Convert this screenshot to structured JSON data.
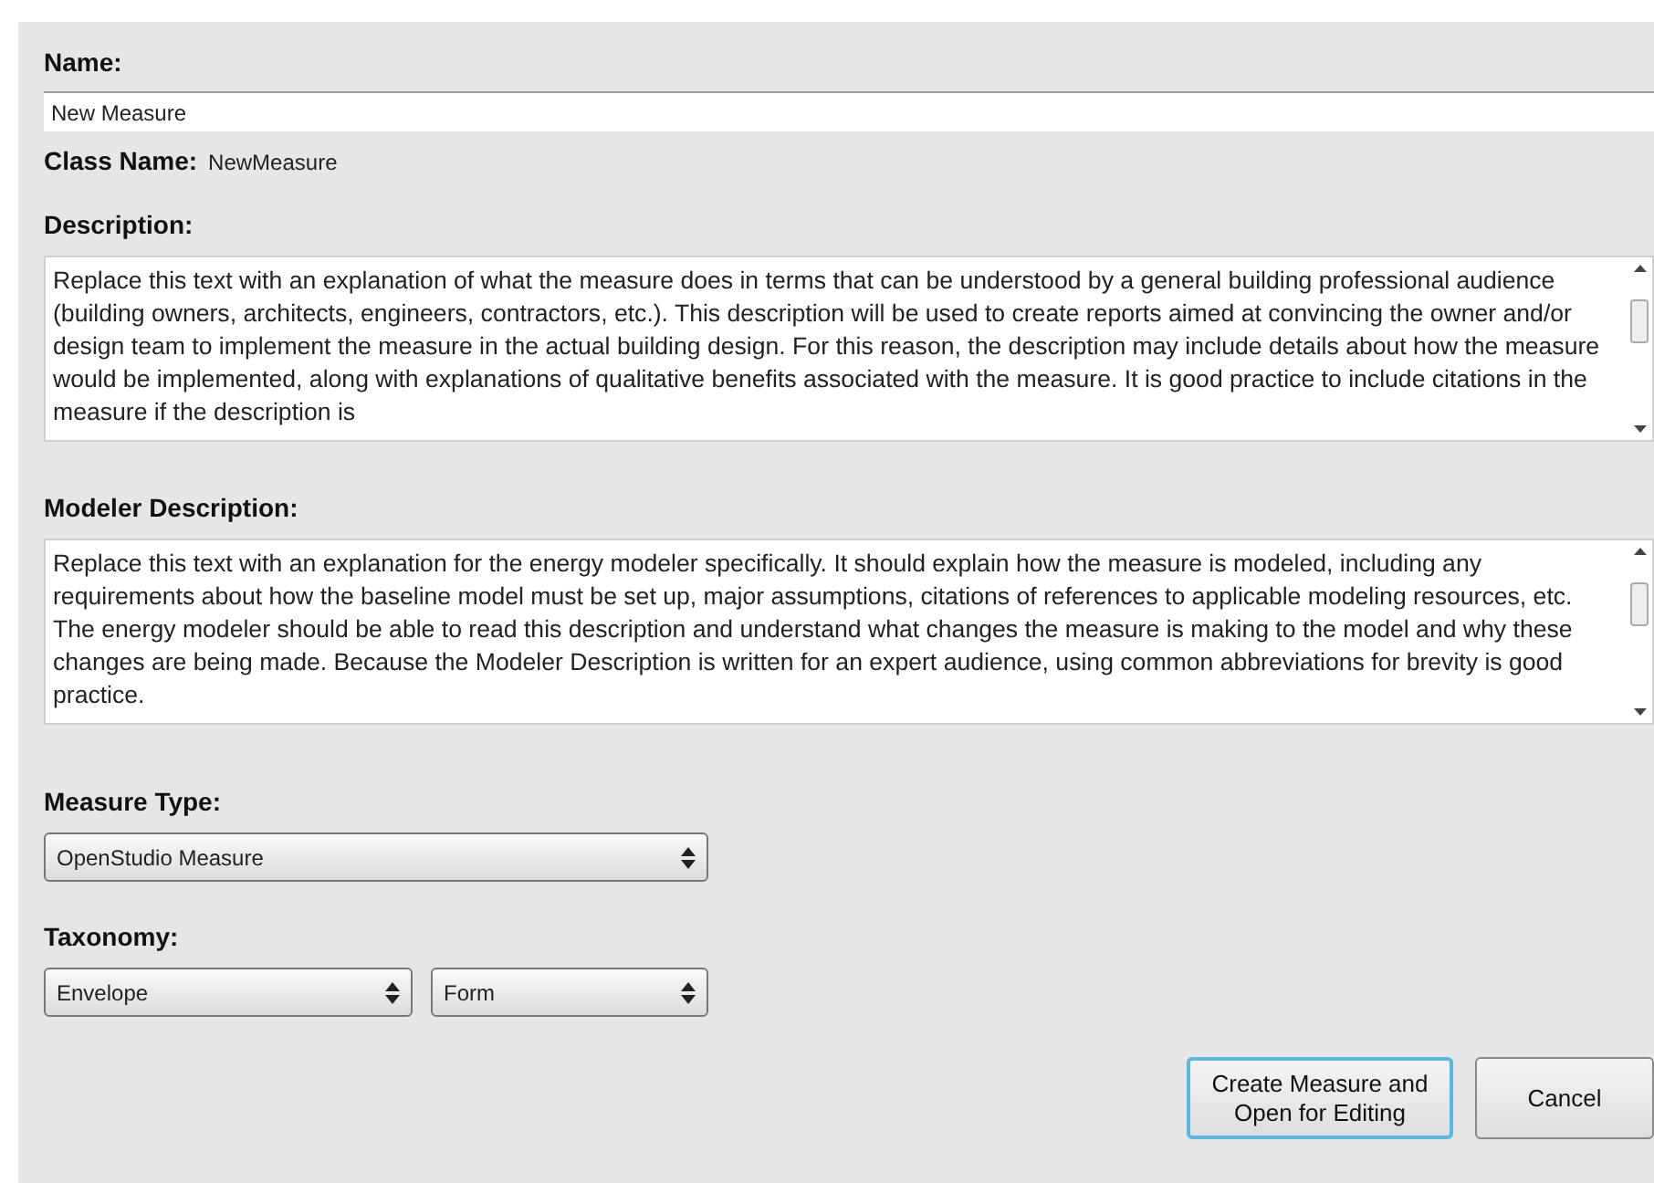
{
  "name": {
    "label": "Name:",
    "value": "New Measure"
  },
  "class_name": {
    "label": "Class Name:",
    "value": "NewMeasure"
  },
  "description": {
    "label": "Description:",
    "value": "Replace this text with an explanation of what the measure does in terms that can be understood by a general building professional audience (building owners, architects, engineers, contractors, etc.).  This description will be used to create reports aimed at convincing the owner and/or design team to implement the measure in the actual building design.  For this reason, the description may include details about how the measure would be implemented, along with explanations of qualitative benefits associated with the measure.  It is good practice to include citations in the measure if the description is"
  },
  "modeler_description": {
    "label": "Modeler Description:",
    "value": "Replace this text with an explanation for the energy modeler specifically.  It should explain how the measure is modeled, including any requirements about how the baseline model must be set up, major assumptions, citations of references to applicable modeling resources, etc.  The energy modeler should be able to read this description and understand what changes the measure is making to the model and why these changes are being made.  Because the Modeler Description is written for an expert audience, using common abbreviations for brevity is good practice."
  },
  "measure_type": {
    "label": "Measure Type:",
    "value": "OpenStudio Measure"
  },
  "taxonomy": {
    "label": "Taxonomy:",
    "values": [
      "Envelope",
      "Form"
    ]
  },
  "buttons": [
    {
      "label": "Create Measure and Open for Editing",
      "focused": true
    },
    {
      "label": "Cancel",
      "focused": false
    }
  ]
}
